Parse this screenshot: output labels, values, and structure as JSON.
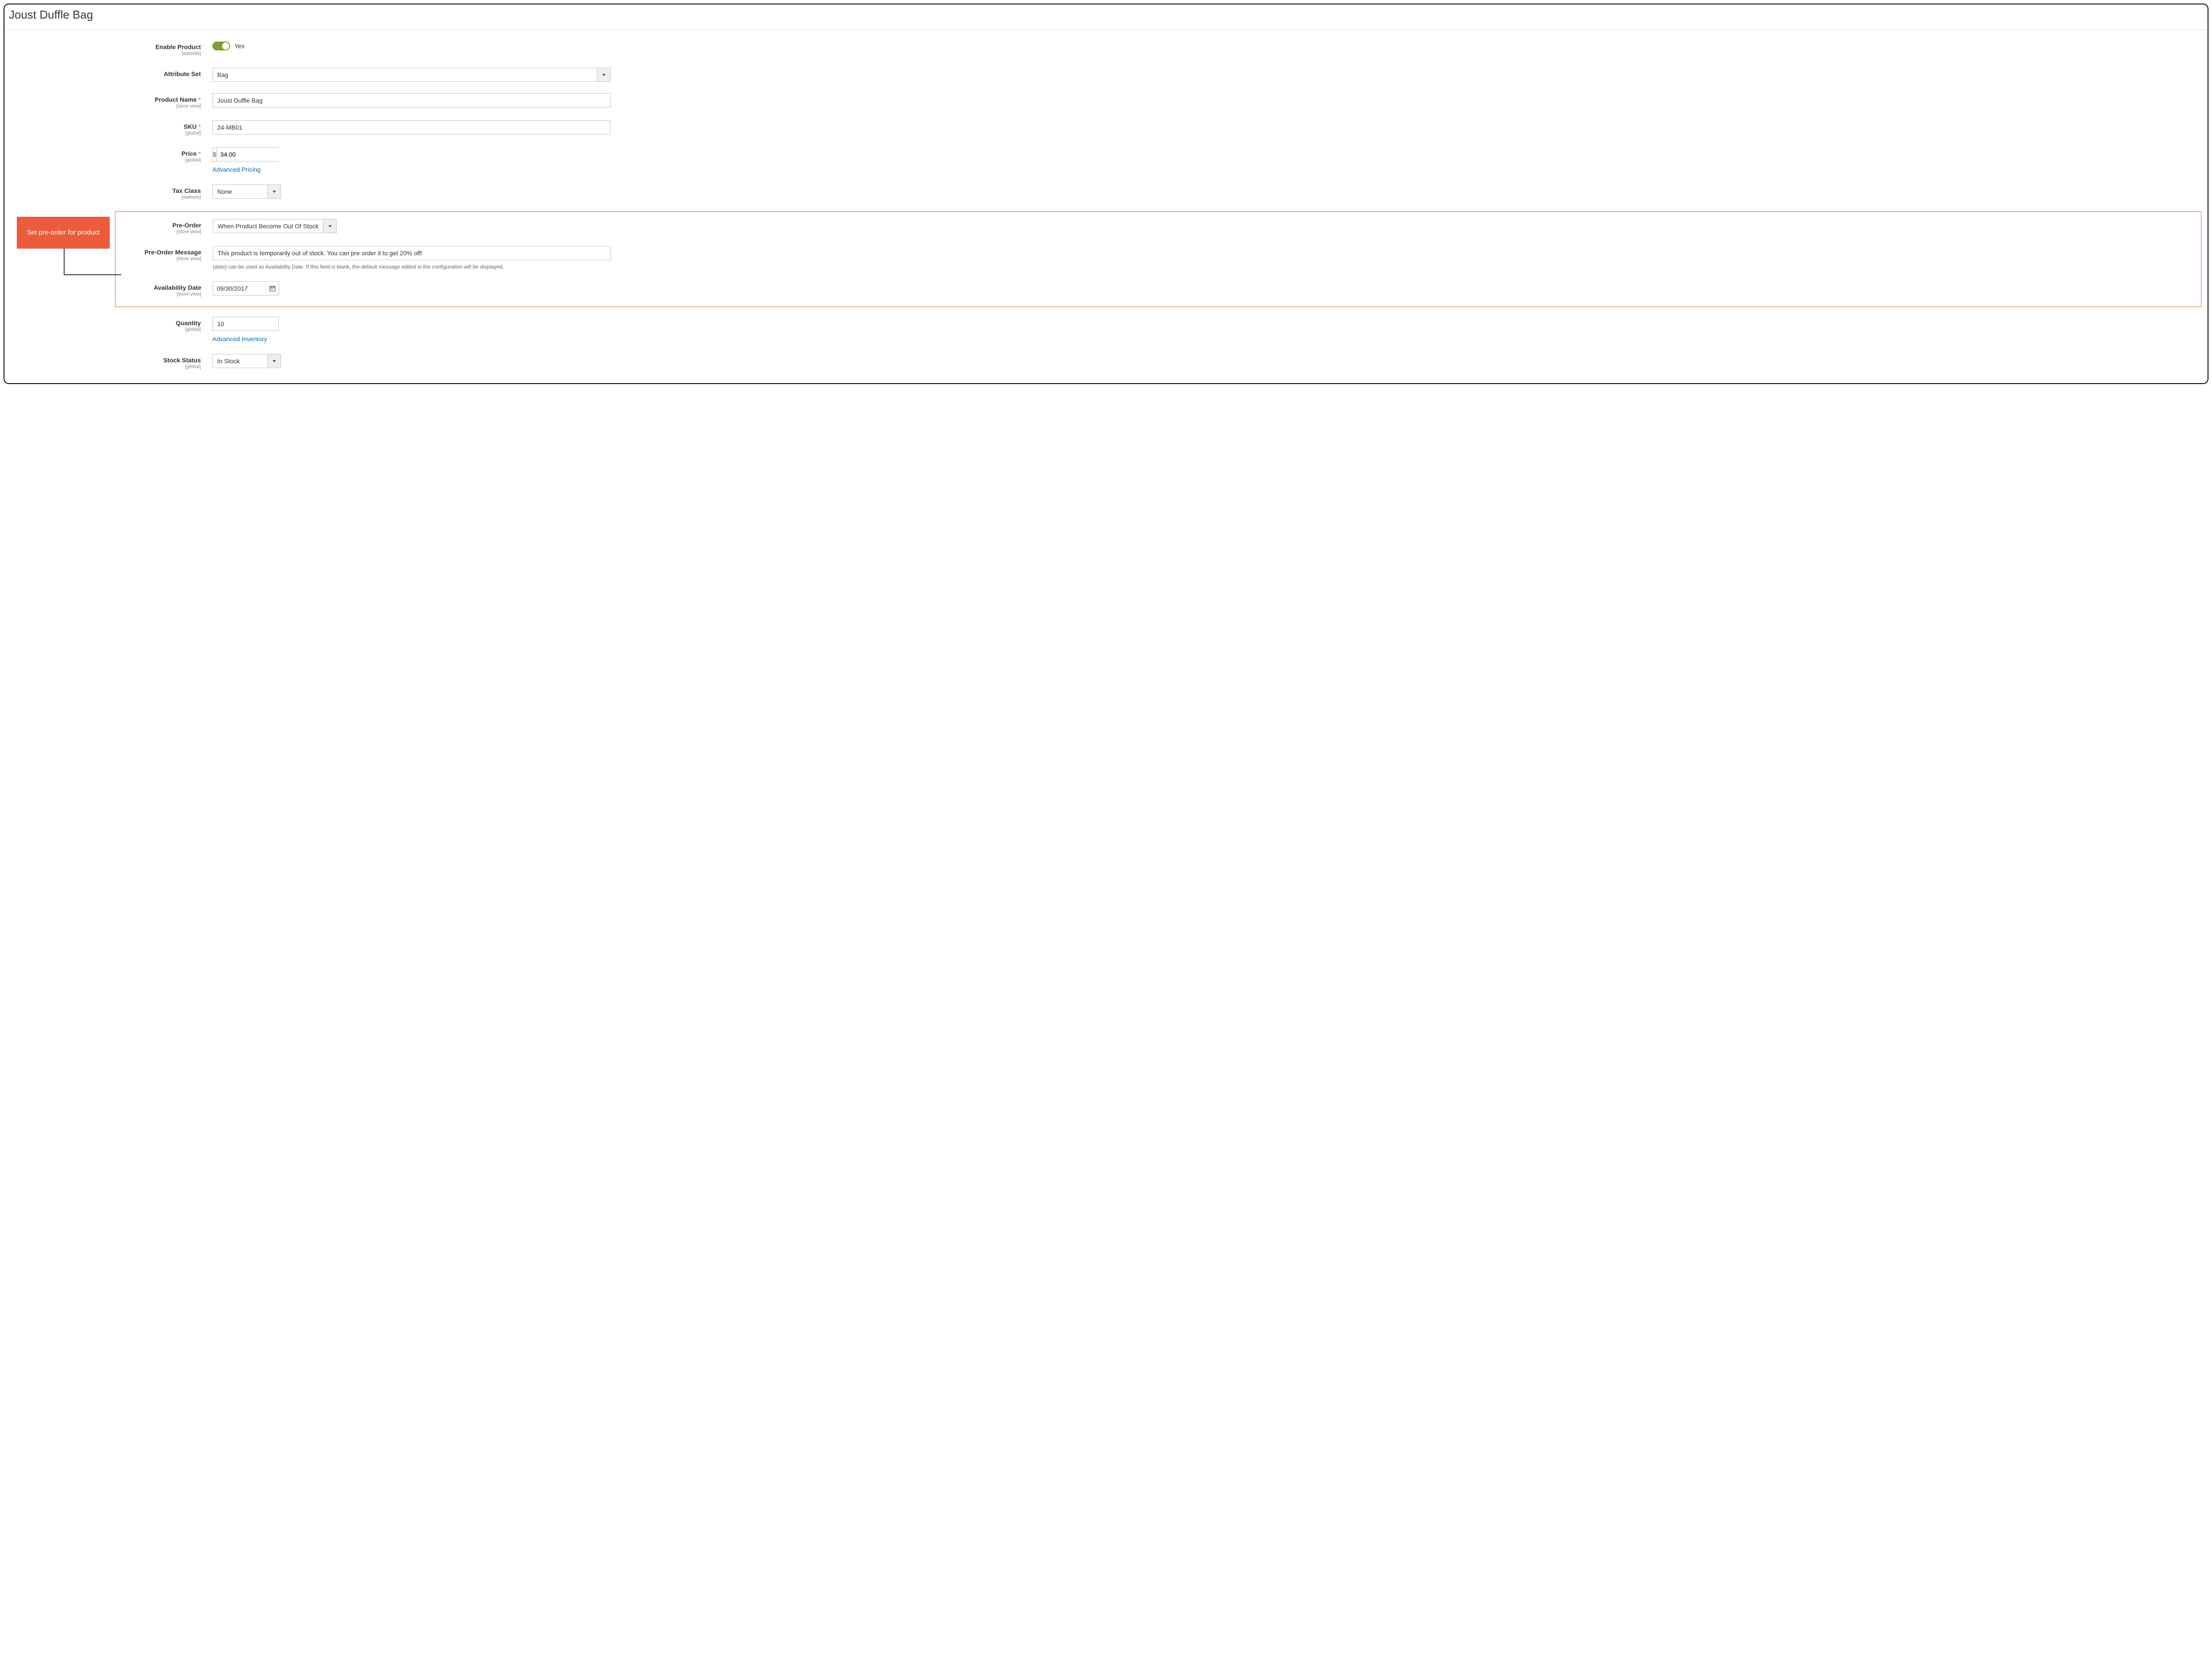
{
  "pageTitle": "Joust Duffle Bag",
  "callout": {
    "text": "Set pre-order for product"
  },
  "fields": {
    "enableProduct": {
      "label": "Enable Product",
      "scope": "[website]",
      "valueText": "Yes"
    },
    "attributeSet": {
      "label": "Attribute Set",
      "value": "Bag"
    },
    "productName": {
      "label": "Product Name",
      "scope": "[store view]",
      "required": "*",
      "value": "Joust Duffle Bag"
    },
    "sku": {
      "label": "SKU",
      "scope": "[global]",
      "required": "*",
      "value": "24-MB01"
    },
    "price": {
      "label": "Price",
      "scope": "[global]",
      "required": "*",
      "prefix": "$",
      "value": "34.00",
      "advancedLink": "Advanced Pricing"
    },
    "taxClass": {
      "label": "Tax Class",
      "scope": "[website]",
      "value": "None"
    },
    "preOrder": {
      "label": "Pre-Order",
      "scope": "[store view]",
      "value": "When Product Become Out Of Stock"
    },
    "preOrderMsg": {
      "label": "Pre-Order Message",
      "scope": "[store view]",
      "value": "This product is temporarily out of stock. You can pre order it to get 20% off!",
      "helper": "{date} can be used as Availability Date. If this field is blank, the default message edited in the configuration will be displayed."
    },
    "availDate": {
      "label": "Availability Date",
      "scope": "[store view]",
      "value": "09/30/2017"
    },
    "quantity": {
      "label": "Quantity",
      "scope": "[global]",
      "value": "10",
      "advancedLink": "Advanced Inventory"
    },
    "stockStatus": {
      "label": "Stock Status",
      "scope": "[global]",
      "value": "In Stock"
    }
  }
}
